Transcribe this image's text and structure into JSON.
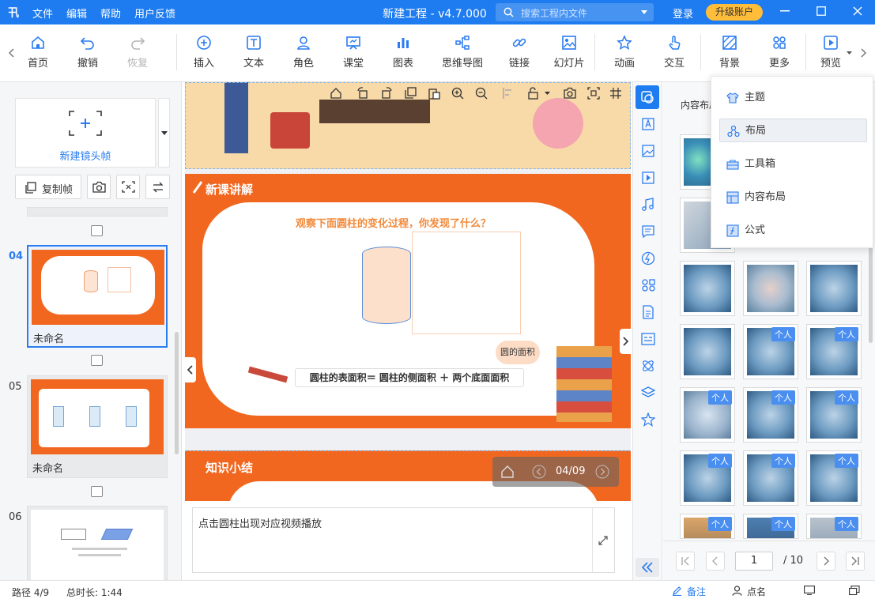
{
  "titlebar": {
    "menus": [
      "文件",
      "编辑",
      "帮助",
      "用户反馈"
    ],
    "title": "新建工程 - v4.7.000",
    "search_placeholder": "搜索工程内文件",
    "login": "登录",
    "upgrade": "升级账户"
  },
  "toolbar": {
    "home": "首页",
    "undo": "撤销",
    "redo": "恢复",
    "insert": "插入",
    "text": "文本",
    "role": "角色",
    "classroom": "课堂",
    "chart": "图表",
    "mindmap": "思维导图",
    "link": "链接",
    "slide": "幻灯片",
    "animation": "动画",
    "interact": "交互",
    "background": "背景",
    "more": "更多",
    "preview": "预览"
  },
  "left": {
    "new_frame": "新建镜头帧",
    "copy_frame": "复制帧",
    "frames": [
      {
        "num": "04",
        "label": "未命名"
      },
      {
        "num": "05",
        "label": "未命名"
      },
      {
        "num": "06",
        "label": ""
      }
    ]
  },
  "slide": {
    "banner": "新课讲解",
    "question": "观察下面圆柱的变化过程，你发现了什么？",
    "bubble": "圆的面积",
    "formula": "圆柱的表面积＝ 圆柱的侧面积 ＋ 两个底面面积",
    "next_banner": "知识小结",
    "page": "04/09"
  },
  "notes": "点击圆柱出现对应视频播放",
  "right_panel": {
    "header": "内容布局",
    "badge": "个人",
    "page_current": "1",
    "page_total": "/ 10"
  },
  "dropdown": {
    "items": [
      "主题",
      "布局",
      "工具箱",
      "内容布局",
      "公式"
    ]
  },
  "status": {
    "path": "路径 4/9",
    "duration": "总时长: 1:44",
    "notes": "备注",
    "rollcall": "点名"
  },
  "colors": {
    "accent": "#1e7cf0",
    "slide_orange": "#f2671f",
    "upgrade": "#ffbd3a"
  }
}
